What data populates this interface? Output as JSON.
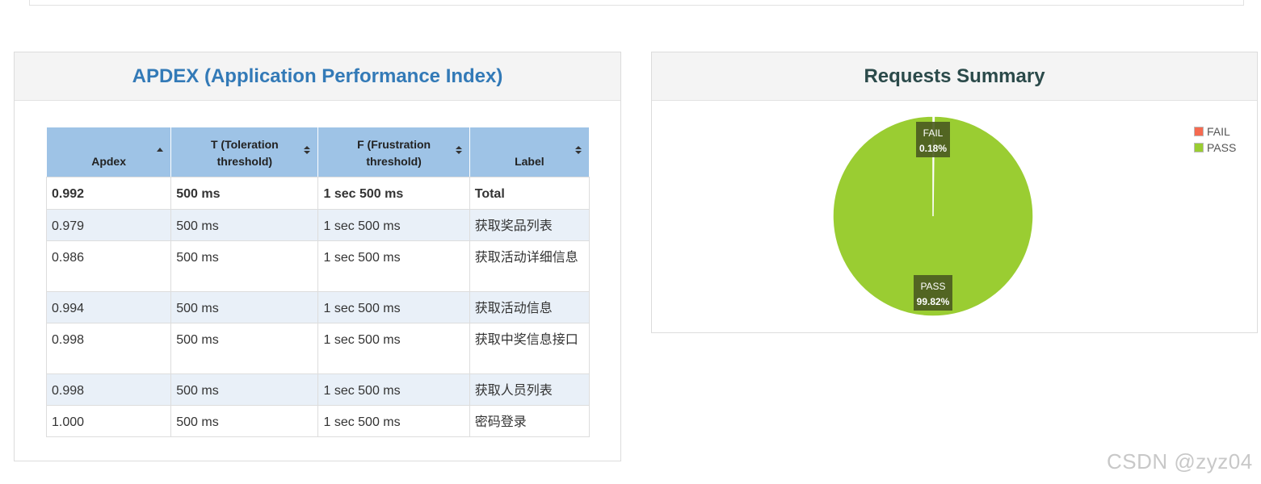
{
  "apdex": {
    "title": "APDEX (Application Performance Index)",
    "columns": [
      "Apdex",
      "T (Toleration threshold)",
      "F (Frustration threshold)",
      "Label"
    ],
    "total": {
      "apdex": "0.992",
      "t": "500 ms",
      "f": "1 sec 500 ms",
      "label": "Total"
    },
    "rows": [
      {
        "apdex": "0.979",
        "t": "500 ms",
        "f": "1 sec 500 ms",
        "label": "获取奖品列表"
      },
      {
        "apdex": "0.986",
        "t": "500 ms",
        "f": "1 sec 500 ms",
        "label": "获取活动详细信息"
      },
      {
        "apdex": "0.994",
        "t": "500 ms",
        "f": "1 sec 500 ms",
        "label": "获取活动信息"
      },
      {
        "apdex": "0.998",
        "t": "500 ms",
        "f": "1 sec 500 ms",
        "label": "获取中奖信息接口"
      },
      {
        "apdex": "0.998",
        "t": "500 ms",
        "f": "1 sec 500 ms",
        "label": "获取人员列表"
      },
      {
        "apdex": "1.000",
        "t": "500 ms",
        "f": "1 sec 500 ms",
        "label": "密码登录"
      }
    ],
    "sort_icons": [
      "sort-asc-icon",
      "sort-both-icon",
      "sort-both-icon",
      "sort-both-icon"
    ]
  },
  "summary": {
    "title": "Requests Summary"
  },
  "chart_data": {
    "type": "pie",
    "title": "Requests Summary",
    "slices": [
      {
        "name": "FAIL",
        "value": 0.18,
        "label": "0.18%",
        "color": "#f56a50"
      },
      {
        "name": "PASS",
        "value": 99.82,
        "label": "99.82%",
        "color": "#9acd32"
      }
    ],
    "legend": [
      "FAIL",
      "PASS"
    ],
    "legend_position": "top-right"
  },
  "watermark": "CSDN @zyz04"
}
